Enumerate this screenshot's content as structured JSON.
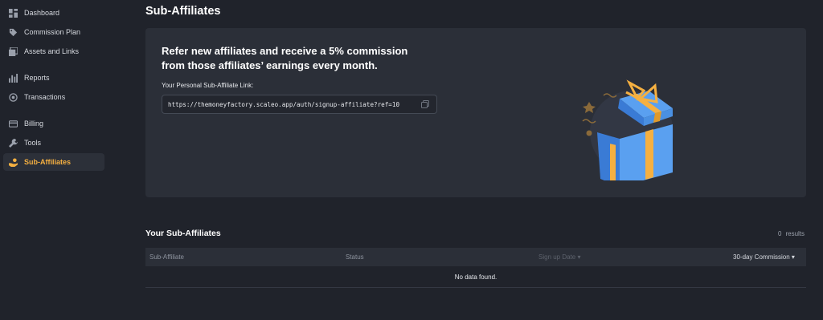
{
  "sidebar": {
    "items": [
      {
        "label": "Dashboard",
        "icon": "dashboard-icon"
      },
      {
        "label": "Commission Plan",
        "icon": "tag-icon"
      },
      {
        "label": "Assets and Links",
        "icon": "assets-icon"
      },
      {
        "label": "Reports",
        "icon": "bar-chart-icon"
      },
      {
        "label": "Transactions",
        "icon": "transactions-icon"
      },
      {
        "label": "Billing",
        "icon": "card-icon"
      },
      {
        "label": "Tools",
        "icon": "wrench-icon"
      },
      {
        "label": "Sub-Affiliates",
        "icon": "hand-coins-icon",
        "active": true
      }
    ]
  },
  "page": {
    "title": "Sub-Affiliates"
  },
  "hero": {
    "headline_1": "Refer new affiliates and receive a 5% commission",
    "headline_2": "from those affiliates’ earnings every month.",
    "link_label": "Your Personal Sub-Affiliate Link:",
    "link_value": "https://themoneyfactory.scaleo.app/auth/signup-affiliate?ref=10",
    "illustration": "gift-box-illustration"
  },
  "table": {
    "title": "Your Sub-Affiliates",
    "results_count": "0",
    "results_label": "results",
    "columns": [
      "Sub-Affiliate",
      "Status",
      "Sign up Date ▾",
      "30-day Commission ▾"
    ],
    "empty_text": "No data found."
  },
  "colors": {
    "background": "#20232b",
    "panel": "#2b2f38",
    "accent": "#f5b041",
    "gift_blue": "#4a90e2",
    "gift_ribbon": "#f5b041"
  }
}
